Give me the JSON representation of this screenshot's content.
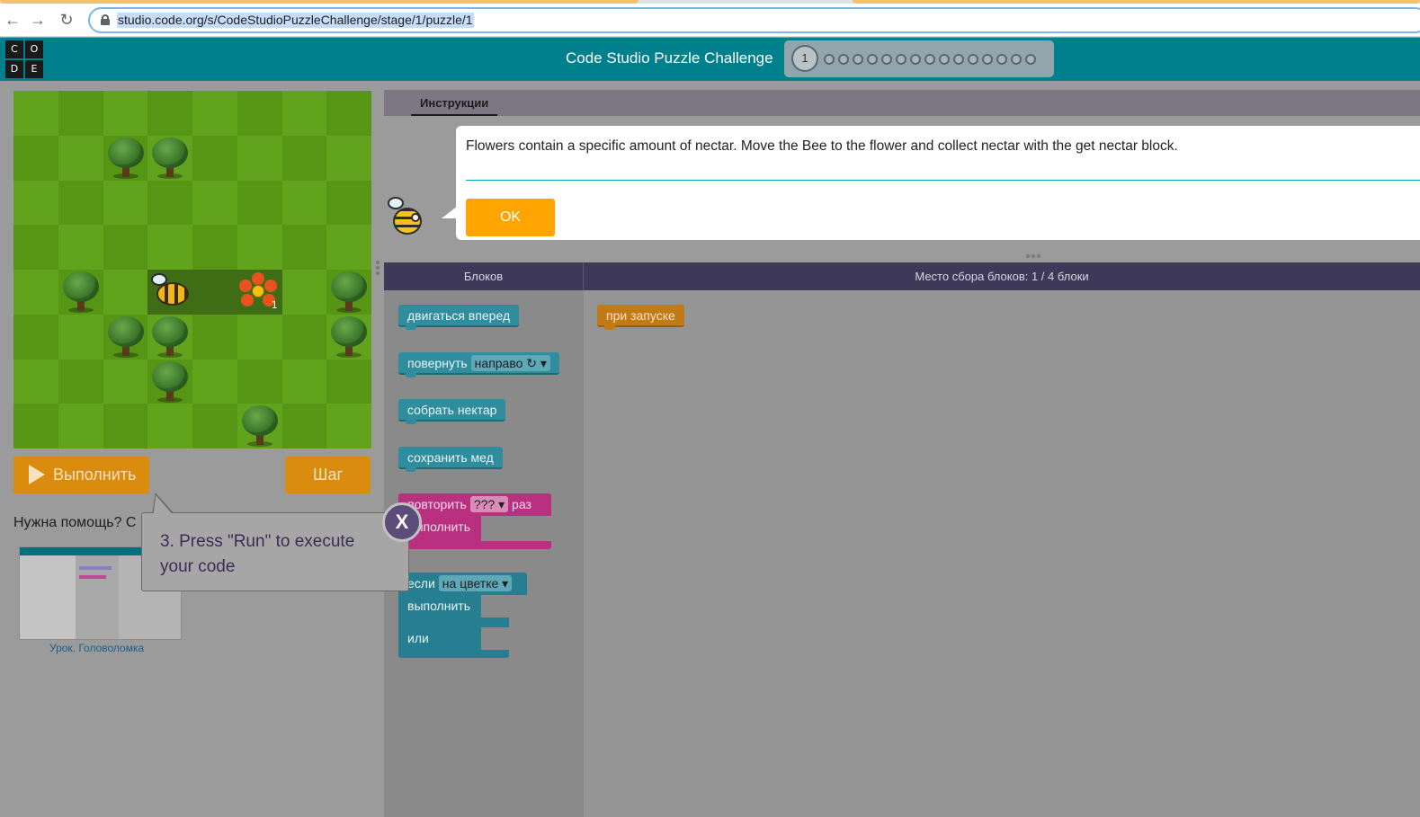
{
  "browser": {
    "url": "studio.code.org/s/CodeStudioPuzzleChallenge/stage/1/puzzle/1"
  },
  "header": {
    "logo_letters": [
      "C",
      "O",
      "D",
      "E"
    ],
    "title": "Code Studio Puzzle Challenge",
    "current_level": "1",
    "remaining_levels": 15
  },
  "controls": {
    "run_label": "Выполнить",
    "step_label": "Шаг"
  },
  "help": {
    "text": "Нужна помощь? С",
    "video_caption": "Урок. Головоломка"
  },
  "instructions": {
    "tab_label": "Инструкции",
    "text": "Flowers contain a specific amount of nectar. Move the Bee to the flower and collect nectar with the get nectar block.",
    "ok_label": "OK"
  },
  "blockly": {
    "toolbox_title": "Блоков",
    "workspace_title": "Место сбора блоков: 1 / 4 блоки",
    "toolbox_blocks": {
      "move_forward": "двигаться вперед",
      "turn_label": "повернуть",
      "turn_option": "направо ↻ ▾",
      "get_nectar": "собрать нектар",
      "make_honey": "сохранить мед",
      "repeat_label": "повторить",
      "repeat_option": "??? ▾",
      "repeat_suffix": "раз",
      "repeat_do": "выполнить",
      "if_label": "если",
      "if_option": "на цветке ▾",
      "if_do": "выполнить",
      "if_else": "или"
    },
    "workspace_blocks": {
      "when_run": "при запуске"
    }
  },
  "tooltip": {
    "text": "3. Press \"Run\" to execute your code",
    "close_label": "X"
  },
  "maze": {
    "flower_nectar": "1"
  }
}
